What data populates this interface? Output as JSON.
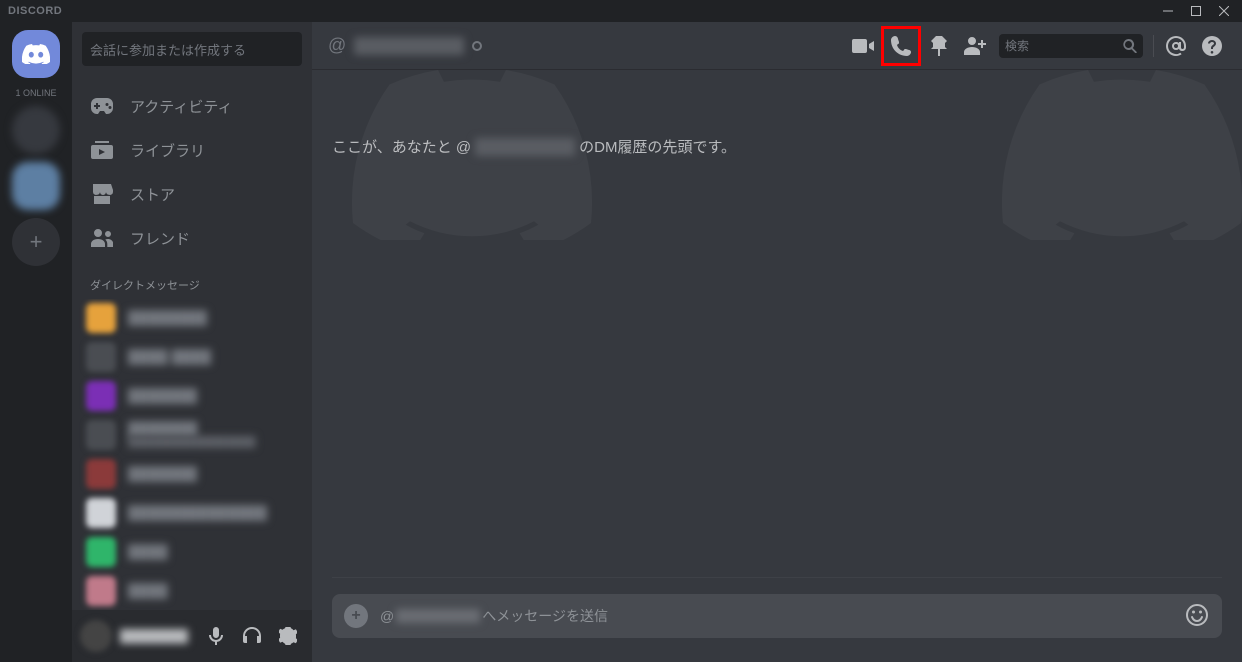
{
  "app": {
    "wordmark": "DISCORD"
  },
  "serverRail": {
    "onlineLabel": "1 ONLINE",
    "addLabel": "+"
  },
  "sidebar": {
    "searchPlaceholder": "会話に参加または作成する",
    "nav": [
      {
        "label": "アクティビティ"
      },
      {
        "label": "ライブラリ"
      },
      {
        "label": "ストア"
      },
      {
        "label": "フレンド"
      }
    ],
    "dmHeader": "ダイレクトメッセージ",
    "dmItems": [
      {
        "color": "#e6a23c",
        "name": "████████"
      },
      {
        "color": "#4a4d52",
        "name": "████ ████"
      },
      {
        "color": "#7b2fb5",
        "name": "███████"
      },
      {
        "color": "#4a4d52",
        "name": "███████",
        "sub": "██████████████████"
      },
      {
        "color": "#8b3a3a",
        "name": "███████"
      },
      {
        "color": "#d0d3d8",
        "name": "██████████████"
      },
      {
        "color": "#2fb56a",
        "name": "████"
      },
      {
        "color": "#c07a8a",
        "name": "████"
      }
    ],
    "user": {
      "name": "████████"
    }
  },
  "chat": {
    "at": "@",
    "username": "██████████",
    "intro_pre": "ここが、あなたと @",
    "intro_post": " のDM履歴の先頭です。",
    "searchPlaceholder": "検索",
    "composer_pre": "@",
    "composer_post": " へメッセージを送信",
    "addSymbol": "+"
  }
}
